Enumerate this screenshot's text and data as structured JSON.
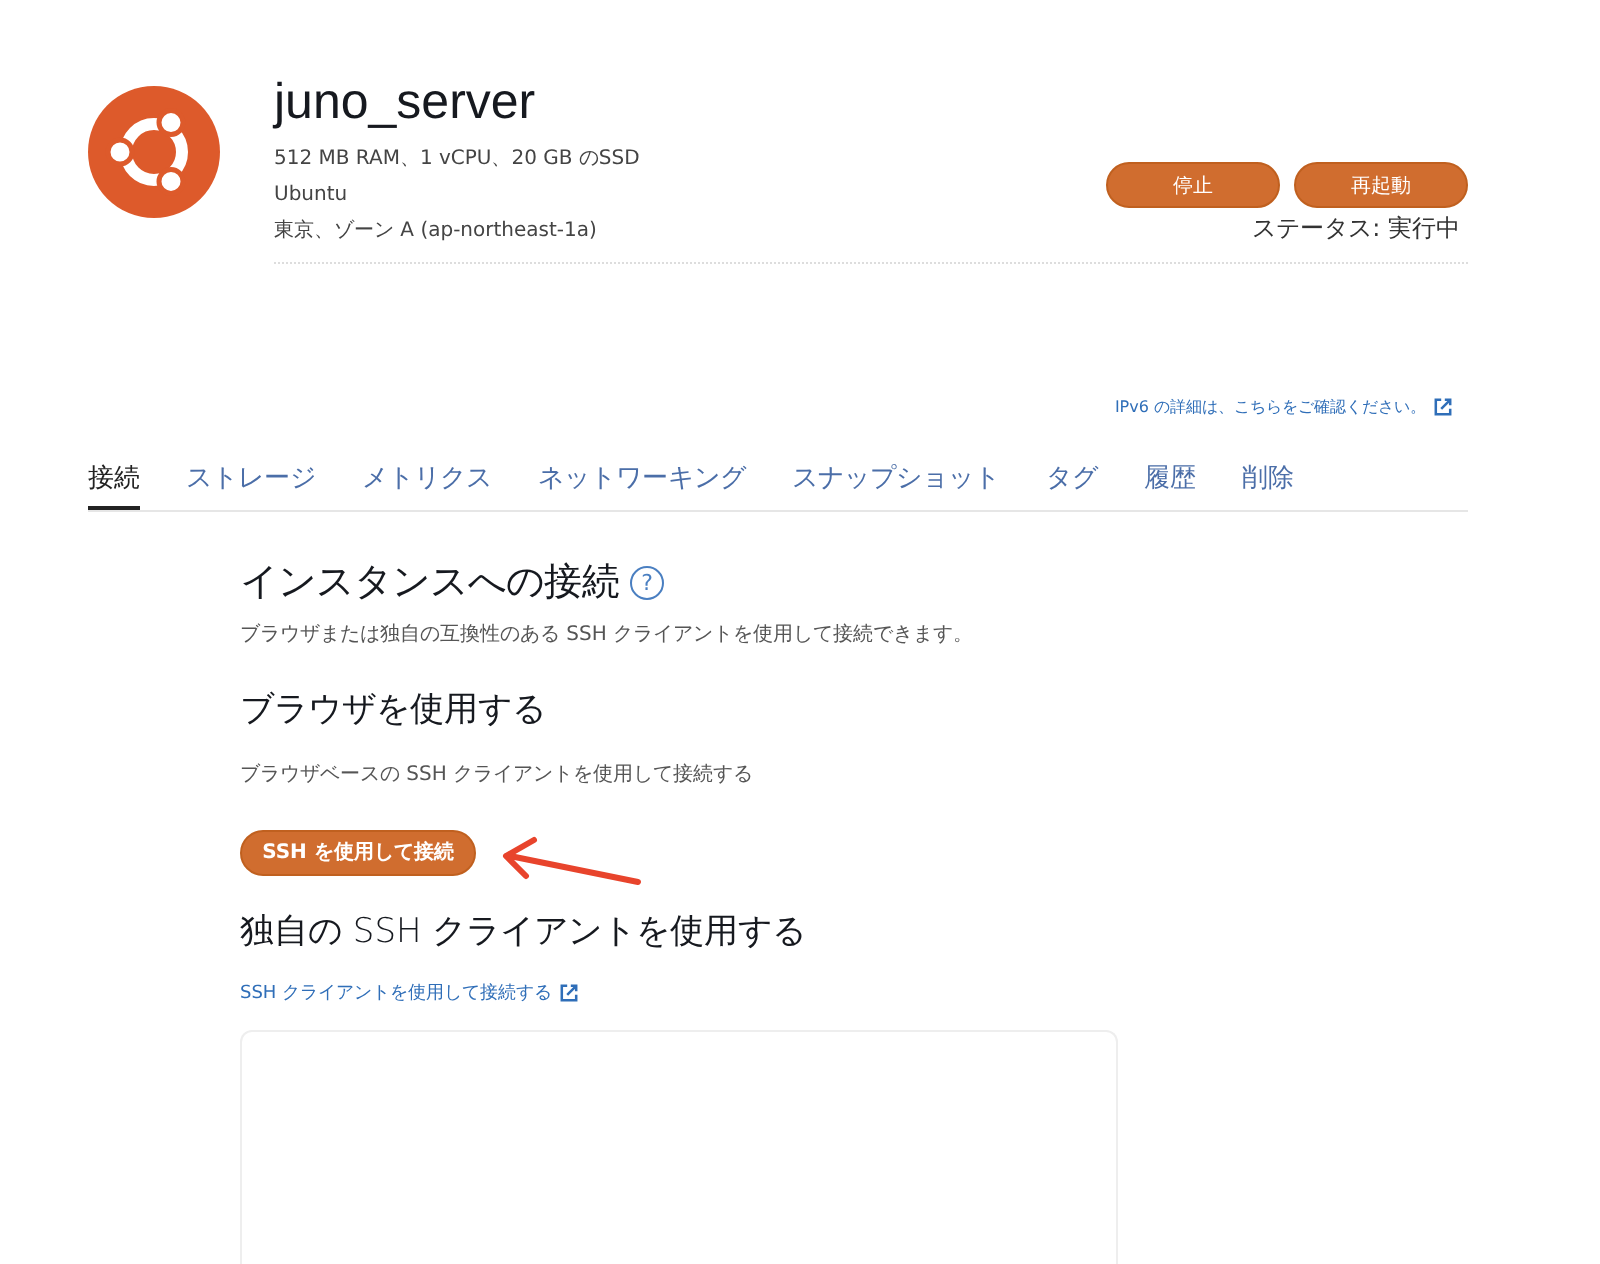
{
  "instance": {
    "name": "juno_server",
    "details": [
      "512 MB RAM、1 vCPU、20 GB のSSD",
      "Ubuntu",
      "東京、ゾーン A (ap-northeast-1a)"
    ],
    "actions": [
      "停止",
      "再起動"
    ],
    "status": "ステータス: 実行中"
  },
  "ipv6_link": "IPv6 の詳細は、こちらをご確認ください。",
  "tabs": [
    {
      "label": "接続",
      "selected": true
    },
    {
      "label": "ストレージ",
      "selected": false
    },
    {
      "label": "メトリクス",
      "selected": false
    },
    {
      "label": "ネットワーキング",
      "selected": false
    },
    {
      "label": "スナップショット",
      "selected": false
    },
    {
      "label": "タグ",
      "selected": false
    },
    {
      "label": "履歴",
      "selected": false
    },
    {
      "label": "削除",
      "selected": false
    }
  ],
  "connect": {
    "title": "インスタンスへの接続",
    "help": "?",
    "description": "ブラウザまたは独自の互換性のある SSH クライアントを使用して接続できます。",
    "browser": {
      "title": "ブラウザを使用する",
      "description": "ブラウザベースの SSH クライアントを使用して接続する",
      "button": "SSH を使用して接続"
    },
    "own_client": {
      "title": "独自の SSH クライアントを使用する",
      "link": "SSH クライアントを使用して接続する"
    }
  }
}
